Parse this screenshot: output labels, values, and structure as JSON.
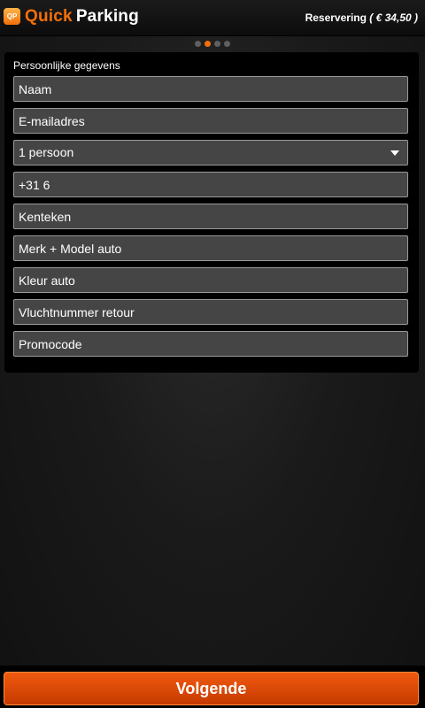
{
  "header": {
    "logo_icon_text": "QP",
    "logo_quick": "Quick",
    "logo_parking": "Parking",
    "reservation_label": "Reservering",
    "reservation_price": "( € 34,50 )"
  },
  "pager": {
    "total": 4,
    "active_index": 1,
    "active_color": "#f36f0a"
  },
  "form": {
    "section_title": "Persoonlijke gegevens",
    "name_placeholder": "Naam",
    "email_placeholder": "E-mailadres",
    "persons_value": "1 persoon",
    "phone_value": "+31 6",
    "plate_placeholder": "Kenteken",
    "car_model_placeholder": "Merk + Model auto",
    "car_color_placeholder": "Kleur auto",
    "flight_placeholder": "Vluchtnummer retour",
    "promo_placeholder": "Promocode"
  },
  "footer": {
    "next_label": "Volgende"
  },
  "colors": {
    "accent": "#f36f0a",
    "field_background": "#454545",
    "field_border": "#9a9a9a"
  },
  "icons": {
    "logo": "quickparking-logo-icon",
    "select_arrow": "chevron-down-icon"
  }
}
